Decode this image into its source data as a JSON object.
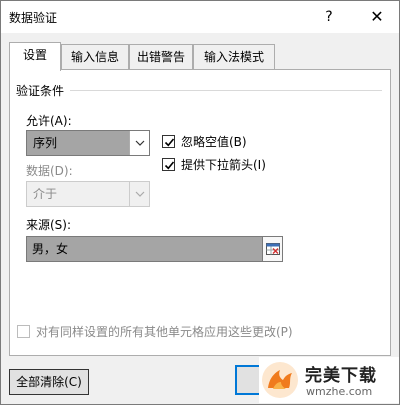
{
  "window": {
    "title": "数据验证",
    "help_glyph": "?",
    "close_glyph": "✕"
  },
  "tabs": [
    {
      "label": "设置",
      "active": true
    },
    {
      "label": "输入信息",
      "active": false
    },
    {
      "label": "出错警告",
      "active": false
    },
    {
      "label": "输入法模式",
      "active": false
    }
  ],
  "validation": {
    "section_title": "验证条件",
    "allow": {
      "label": "允许(A):",
      "value": "序列"
    },
    "data": {
      "label": "数据(D):",
      "value": "介于",
      "disabled": true
    },
    "source": {
      "label": "来源(S):",
      "value": "男，女"
    },
    "ignore_blank": {
      "label": "忽略空值(B)",
      "checked": true
    },
    "in_cell_dropdown": {
      "label": "提供下拉箭头(I)",
      "checked": true
    }
  },
  "apply_all": {
    "label": "对有同样设置的所有其他单元格应用这些更改(P)",
    "checked": false,
    "disabled": true
  },
  "buttons": {
    "clear_all": "全部清除(C)"
  },
  "watermark": {
    "name": "完美下载",
    "url": "wmzhe.com"
  },
  "colors": {
    "focus_border": "#0078d7",
    "selected_field": "#a5a5a5",
    "logo_orange": "#f07b1d"
  }
}
